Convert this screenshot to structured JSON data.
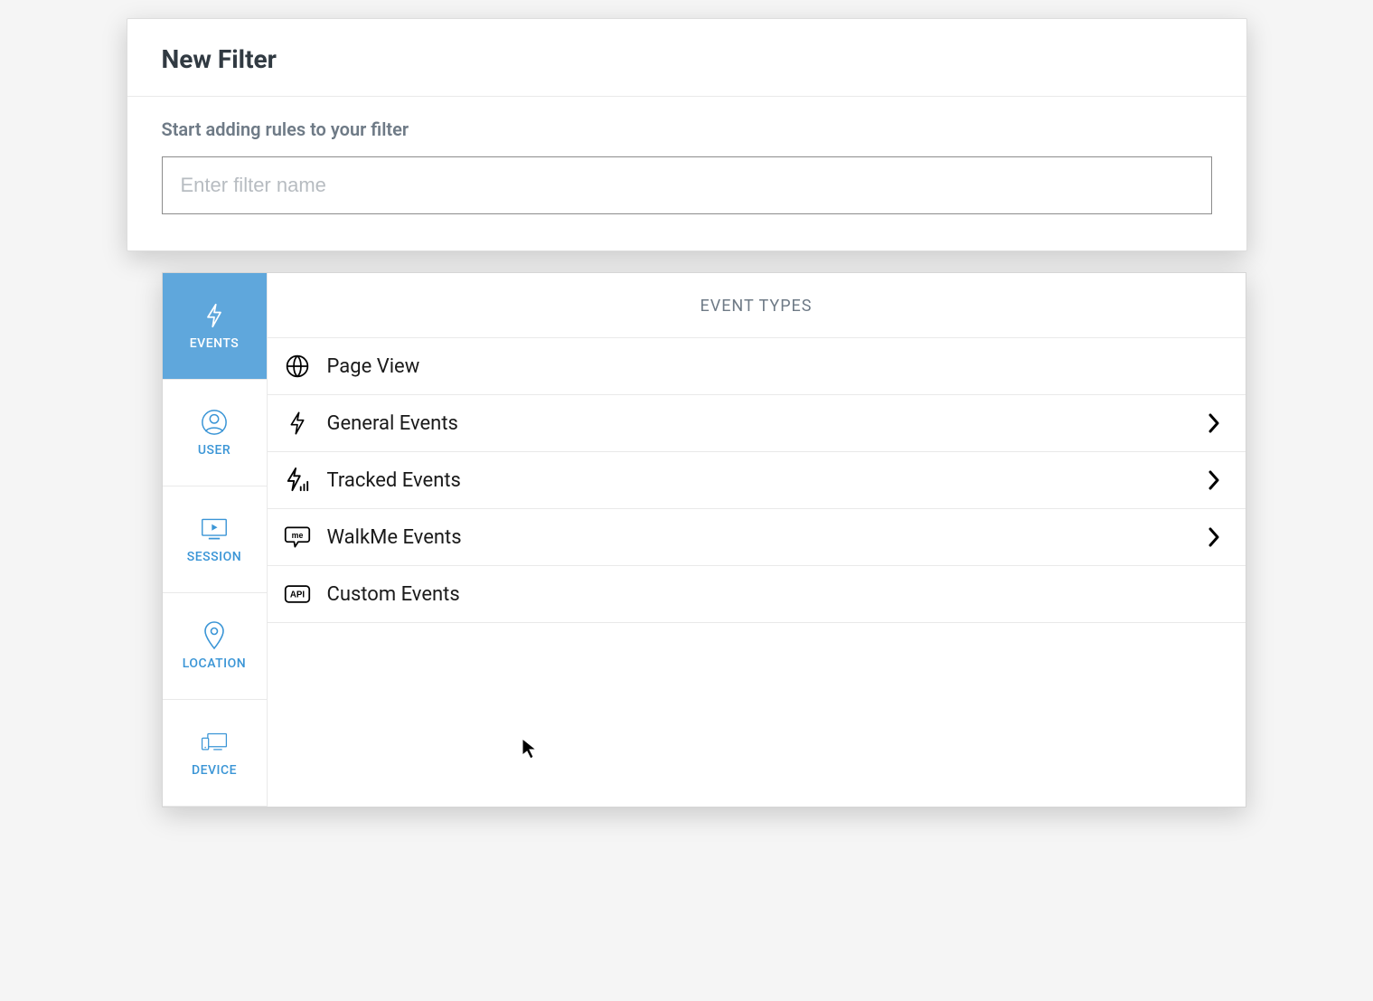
{
  "modal": {
    "title": "New Filter",
    "instruction": "Start adding rules to your filter",
    "filter_name_placeholder": "Enter filter name"
  },
  "side_tabs": [
    {
      "id": "events",
      "label": "EVENTS",
      "icon": "lightning-icon",
      "active": true
    },
    {
      "id": "user",
      "label": "USER",
      "icon": "user-icon",
      "active": false
    },
    {
      "id": "session",
      "label": "SESSION",
      "icon": "session-icon",
      "active": false
    },
    {
      "id": "location",
      "label": "LOCATION",
      "icon": "location-icon",
      "active": false
    },
    {
      "id": "device",
      "label": "DEVICE",
      "icon": "device-icon",
      "active": false
    }
  ],
  "panel": {
    "heading": "EVENT TYPES",
    "rows": [
      {
        "icon": "globe-icon",
        "label": "Page View",
        "has_children": false
      },
      {
        "icon": "lightning-icon",
        "label": "General Events",
        "has_children": true
      },
      {
        "icon": "lightning-bars-icon",
        "label": "Tracked Events",
        "has_children": true
      },
      {
        "icon": "walkme-icon",
        "label": "WalkMe Events",
        "has_children": true
      },
      {
        "icon": "api-icon",
        "label": "Custom Events",
        "has_children": false
      }
    ]
  }
}
